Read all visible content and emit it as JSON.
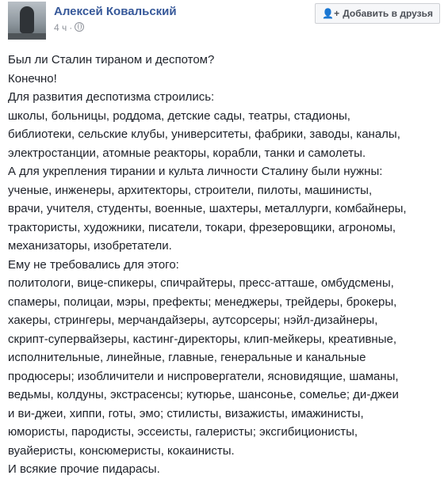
{
  "post": {
    "author": "Алексей Ковальский",
    "time": "4 ч",
    "separator": "·",
    "add_friend_label": "Добавить в друзья",
    "lines": [
      "Был ли Сталин тираном и деспотом?",
      "Конечно!",
      "Для развития деспотизма строились:",
      "школы, больницы, роддома, детские сады, театры, стадионы,",
      "библиотеки, сельские клубы, университеты, фабрики, заводы, каналы,",
      "электростанции, атомные реакторы, корабли, танки и самолеты.",
      "А для укрепления тирании и культа личности Сталину были нужны:",
      "ученые, инженеры, архитекторы, строители, пилоты, машинисты,",
      "врачи, учителя, студенты, военные, шахтеры, металлурги, комбайнеры,",
      "трактористы, художники, писатели, токари, фрезеровщики, агрономы,",
      "механизаторы, изобретатели.",
      "Ему не требовались для этого:",
      "политологи, вице-спикеры, спичрайтеры, пресс-атташе, омбудсмены,",
      "спамеры, полицаи, мэры, префекты; менеджеры, трейдеры, брокеры,",
      "хакеры, стрингеры, мерчандайзеры, аутсорсеры; нэйл-дизайнеры,",
      "скрипт-супервайзеры, кастинг-директоры, клип-мейкеры, креативные,",
      "исполнительные, линейные, главные, генеральные и канальные",
      "продюсеры; изобличители и ниспровергатели, ясновидящие, шаманы,",
      "ведьмы, колдуны, экстрасенсы; кутюрье, шансонье, сомелье; ди-джеи",
      "и ви-джеи, хиппи, готы, эмо; стилисты, визажисты, имажинисты,",
      "юмористы, пародисты, эссеисты, галеристы; эксгибиционисты,",
      "вуайеристы, консюмеристы, кокаинисты.",
      "И всякие прочие пидарасы."
    ]
  },
  "icons": {
    "privacy": "globe-icon",
    "add_friend": "add-friend-icon"
  },
  "colors": {
    "author_link": "#365899",
    "body_text": "#1d2129",
    "meta_text": "#90949c",
    "button_bg": "#f6f7f9",
    "button_border": "#ced0d4"
  }
}
